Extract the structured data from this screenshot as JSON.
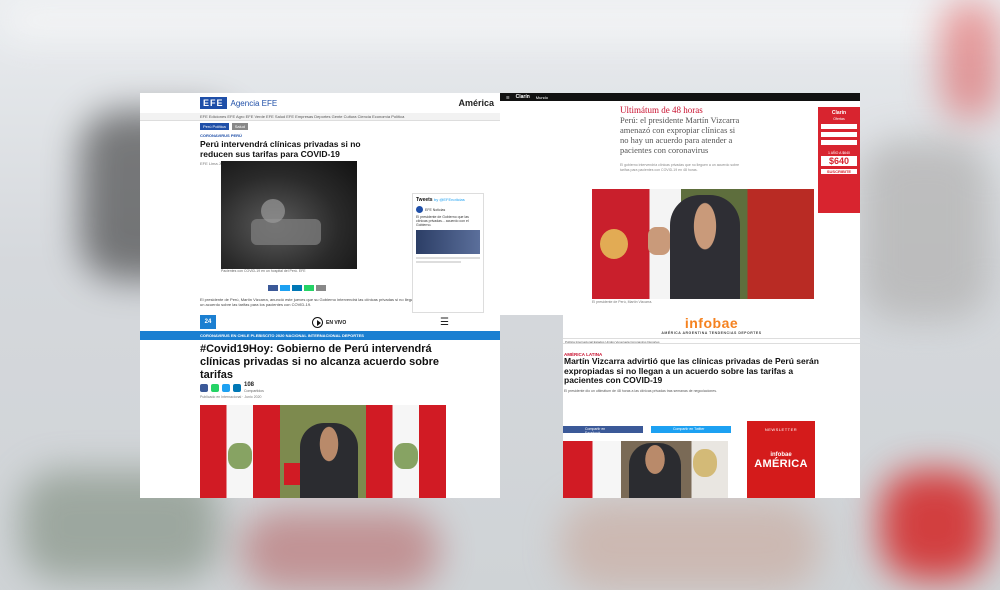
{
  "efe": {
    "logo": "EFE",
    "brand": "Agencia EFE",
    "region": "América",
    "nav": "EFE Ediciones   EFE Agro   EFE Verde   EFE Salud   EFE Empresas   Deportes   Gente   Cultura   Ciencia   Economía   Política",
    "chips": [
      "Perú Política",
      "Salud"
    ],
    "kicker": "CORONAVIRUS PERÚ",
    "title": "Perú intervendrá clínicas privadas si no reducen sus tarifas para COVID-19",
    "date": "EFE  Lima  Junio 2020",
    "caption": "Pacientes con COVID-19 en un hospital del Perú. EFE",
    "body": "El presidente de Perú, Martín Vizcarra, anunció este jueves que su Gobierno intervendrá las clínicas privadas si no llegan a un acuerdo sobre las tarifas para los pacientes con COVID-19.",
    "tweets": {
      "title": "Tweets",
      "by": "by @EFEnoticias",
      "author": "EFE Noticias",
      "text": "El presidente de Gobierno que las clínicas privadas... acuerdo con el Gobierno."
    }
  },
  "clarin": {
    "logo": "Clarín",
    "section": "Mundo",
    "kicker": "Ultimátum de 48 horas",
    "title": "Perú: el presidente Martín Vizcarra amenazó con expropiar clínicas si no hay un acuerdo para atender a pacientes con coronavirus",
    "lead": "El gobierno intervendría clínicas privadas que no lleguen a un acuerdo sobre tarifas para pacientes con COVID-19 en 48 horas.",
    "caption": "El presidente de Perú, Martín Vizcarra.",
    "ad": {
      "brand": "Clarín",
      "sub": "Ofertas",
      "price_label": "1 AÑO A $640",
      "price": "$640",
      "cta": "SUSCRIBITE"
    }
  },
  "horas": {
    "logo": "24",
    "live": "EN VIVO",
    "menu_icon": "☰",
    "nav": "CORONAVIRUS EN CHILE   PLEBISCITO 2020   NACIONAL   INTERNACIONAL   DEPORTES",
    "title": "#Covid19Hoy: Gobierno de Perú intervendrá clínicas privadas si no alcanza acuerdo sobre tarifas",
    "shares_count": "108",
    "shares_label": "Compartidos",
    "date": "Publicado en Internacional · Junio 2020"
  },
  "infobae": {
    "logo": "infobae",
    "regions": "AMÉRICA   ARGENTINA   TENDENCIAS   DEPORTES",
    "nav": "Política Internacional   Estados Unidos   Venezuela   Coronavirus   Deportes",
    "kicker": "AMÉRICA LATINA",
    "title": "Martín Vizcarra advirtió que las clínicas privadas de Perú serán expropiadas si no llegan a un acuerdo sobre las tarifas a pacientes con COVID-19",
    "lead": "El presidente dio un ultimátum de 48 horas a las clínicas privadas tras semanas de negociaciones.",
    "share_fb": "Compartir en Facebook",
    "share_tw": "Compartir en Twitter",
    "ad": {
      "label": "NEWSLETTER",
      "small": "infobae",
      "big": "AMÉRICA"
    }
  },
  "colors": {
    "efe_blue": "#1f4fa8",
    "clarin_red": "#c8102e",
    "horas_blue": "#1b7fd1",
    "infobae_orange": "#f58220"
  }
}
